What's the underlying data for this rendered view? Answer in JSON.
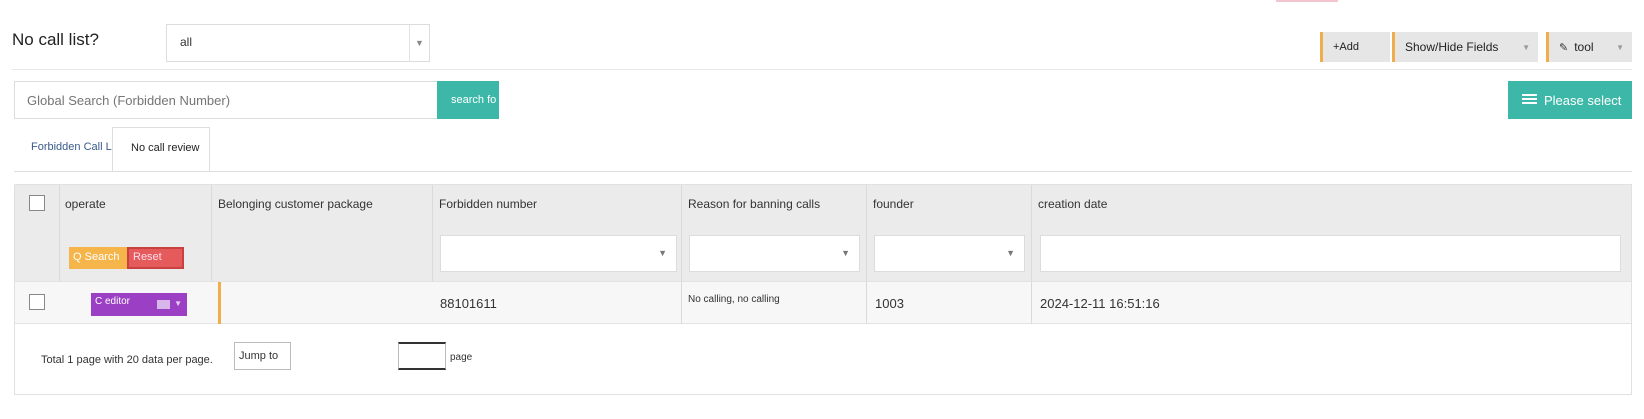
{
  "header": {
    "title": "No call list?",
    "filter_value": "all",
    "add_label": "+Add",
    "show_hide_label": "Show/Hide Fields",
    "tool_label": "tool"
  },
  "search": {
    "placeholder": "Global Search (Forbidden Number)",
    "button_label": "search fo",
    "please_select_label": "Please select"
  },
  "tabs": [
    {
      "label": "Forbidden Call List",
      "active": false
    },
    {
      "label": "No call review",
      "active": true
    }
  ],
  "table": {
    "columns": [
      "operate",
      "Belonging customer package",
      "Forbidden number",
      "Reason for banning calls",
      "founder",
      "creation date"
    ],
    "search_label": "Q Search",
    "reset_label": "Reset",
    "rows": [
      {
        "action_label": "C editor",
        "customer_package": "",
        "forbidden_number": "88101611",
        "reason": "No calling, no calling",
        "founder": "1003",
        "creation_date": "2024-12-11 16:51:16"
      }
    ]
  },
  "pagination": {
    "summary": "Total 1 page with 20 data per page.",
    "jump_label": "Jump to",
    "page_label": "page"
  },
  "colors": {
    "teal": "#3db8a8",
    "orange": "#f0ad4e",
    "purple": "#9b3fc4",
    "red": "#e55a5a"
  }
}
